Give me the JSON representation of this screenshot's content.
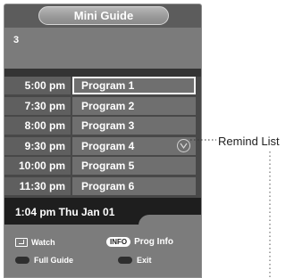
{
  "mini_guide": {
    "title": "Mini Guide",
    "channel": "3",
    "schedule": [
      {
        "time": "5:00 pm",
        "program": "Program 1",
        "selected": true
      },
      {
        "time": "7:30 pm",
        "program": "Program 2",
        "selected": false
      },
      {
        "time": "8:00 pm",
        "program": "Program 3",
        "selected": false
      },
      {
        "time": "9:30 pm",
        "program": "Program 4",
        "selected": false,
        "reminder": true
      },
      {
        "time": "10:00 pm",
        "program": "Program 5",
        "selected": false
      },
      {
        "time": "11:30 pm",
        "program": "Program 6",
        "selected": false
      }
    ],
    "datetime": "1:04 pm Thu Jan 01",
    "help": {
      "watch": "Watch",
      "info_key": "INFO",
      "prog_info": "Prog Info",
      "full_guide": "Full Guide",
      "exit": "Exit"
    }
  },
  "callout": {
    "remind_list": "Remind List",
    "icon": "clock-icon"
  },
  "colors": {
    "panel_bg": "#5c5c5c",
    "row_bg": "#6f6f6f",
    "time_bg": "#5f5f5f",
    "datebar_bg": "#1e1e1e",
    "help_bg": "#7c7c7c",
    "text": "#ffffff"
  }
}
